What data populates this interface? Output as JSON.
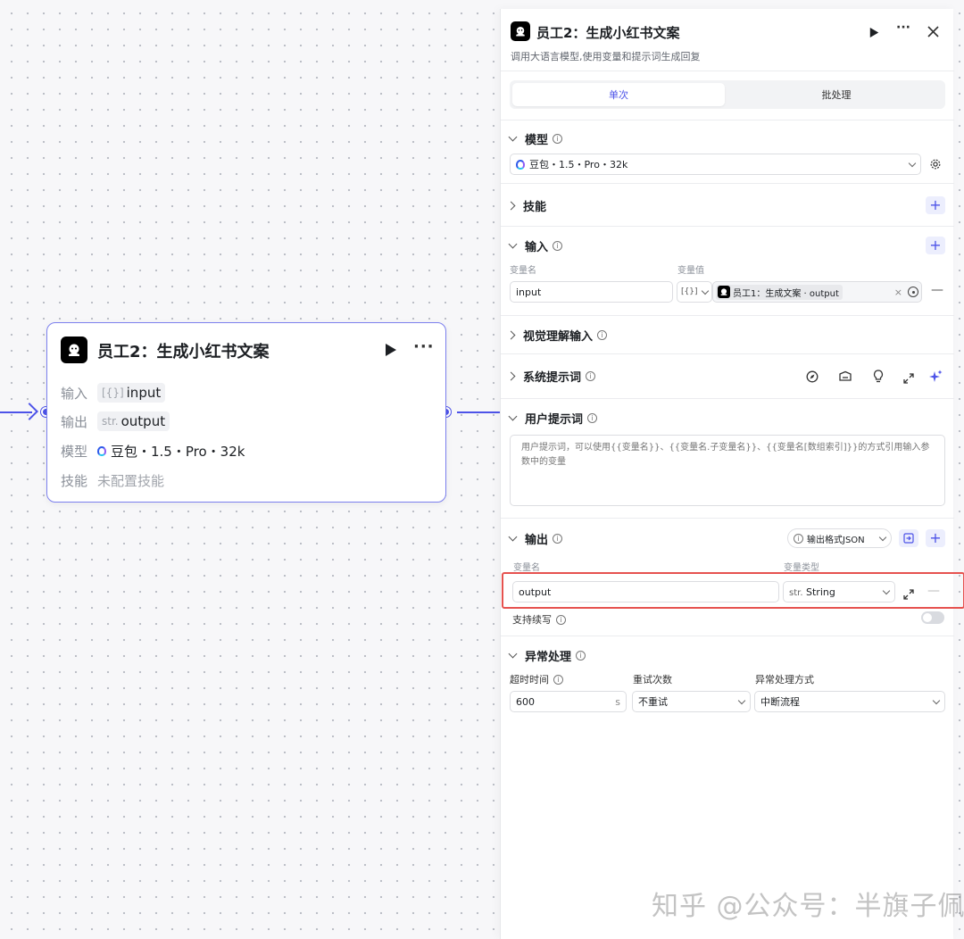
{
  "node": {
    "title": "员工2：生成小红书文案",
    "rows": [
      {
        "key": "输入",
        "tag": "[{}]",
        "value": "input"
      },
      {
        "key": "输出",
        "tag": "str.",
        "value": "output"
      },
      {
        "key": "模型",
        "value": "豆包・1.5・Pro・32k"
      },
      {
        "key": "技能",
        "value": "未配置技能"
      }
    ]
  },
  "panel": {
    "title": "员工2：生成小红书文案",
    "description": "调用大语言模型,使用变量和提示词生成回复",
    "tabs": [
      "单次",
      "批处理"
    ],
    "model": {
      "section": "模型",
      "value": "豆包・1.5・Pro・32k"
    },
    "skills": {
      "section": "技能"
    },
    "inputs": {
      "section": "输入",
      "name_label": "变量名",
      "value_label": "变量值",
      "row": {
        "name": "input",
        "type_tag": "[{}]",
        "ref": "员工1：生成文案 · output"
      }
    },
    "vision": {
      "section": "视觉理解输入"
    },
    "system_prompt": {
      "section": "系统提示词"
    },
    "user_prompt": {
      "section": "用户提示词",
      "placeholder": "用户提示词，可以使用{{变量名}}、{{变量名.子变量名}}、{{变量名[数组索引]}}的方式引用输入参数中的变量"
    },
    "output": {
      "section": "输出",
      "format": "输出格式JSON",
      "name_label": "变量名",
      "type_label": "变量类型",
      "row": {
        "name": "output",
        "type_tag": "str.",
        "type": "String"
      },
      "stream_label": "支持续写"
    },
    "exception": {
      "section": "异常处理",
      "timeout_label": "超时时间",
      "retry_label": "重试次数",
      "mode_label": "异常处理方式",
      "timeout_value": "600",
      "timeout_unit": "s",
      "retry_value": "不重试",
      "mode_value": "中断流程"
    }
  },
  "watermark": "知乎 @公众号：半旗子佩城",
  "icons": {
    "run": "play-icon",
    "more": "more-icon",
    "close": "close-icon",
    "settings": "gear-icon"
  }
}
